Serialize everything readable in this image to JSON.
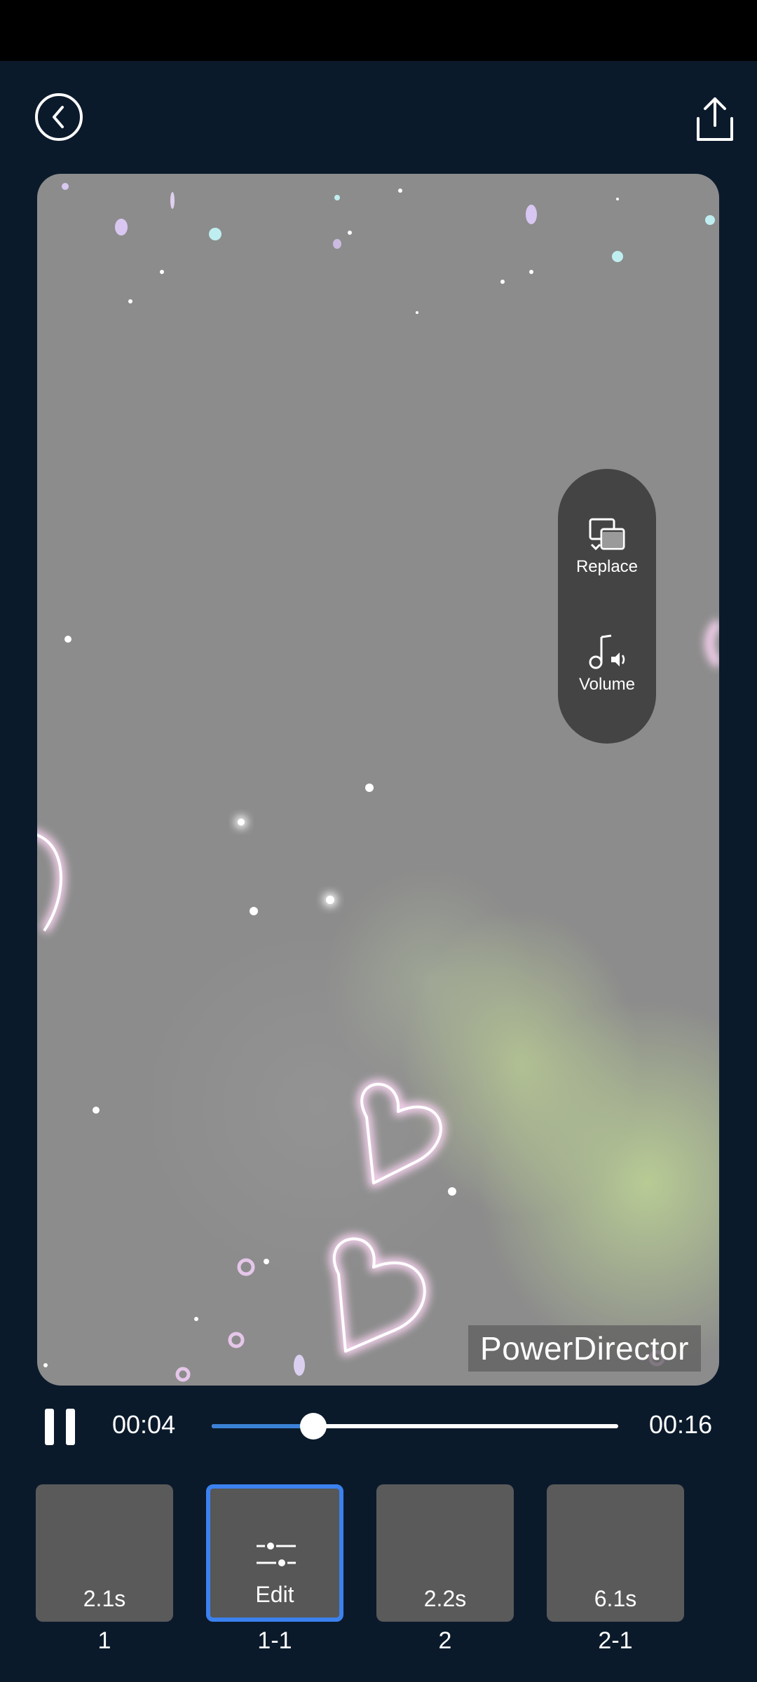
{
  "header": {
    "back_icon": "chevron-left-icon",
    "share_icon": "share-upload-icon"
  },
  "preview": {
    "watermark": "PowerDirector"
  },
  "side_menu": {
    "replace_label": "Replace",
    "volume_label": "Volume"
  },
  "playback": {
    "current_time": "00:04",
    "total_time": "00:16",
    "progress": 0.25
  },
  "clips": [
    {
      "duration": "2.1s",
      "number": "1",
      "selected": false
    },
    {
      "label": "Edit",
      "number": "1-1",
      "selected": true
    },
    {
      "duration": "2.2s",
      "number": "2",
      "selected": false
    },
    {
      "duration": "6.1s",
      "number": "2-1",
      "selected": false
    }
  ],
  "colors": {
    "background": "#0b1a2b",
    "accent": "#3b82f0",
    "status_bar": "#000000"
  }
}
